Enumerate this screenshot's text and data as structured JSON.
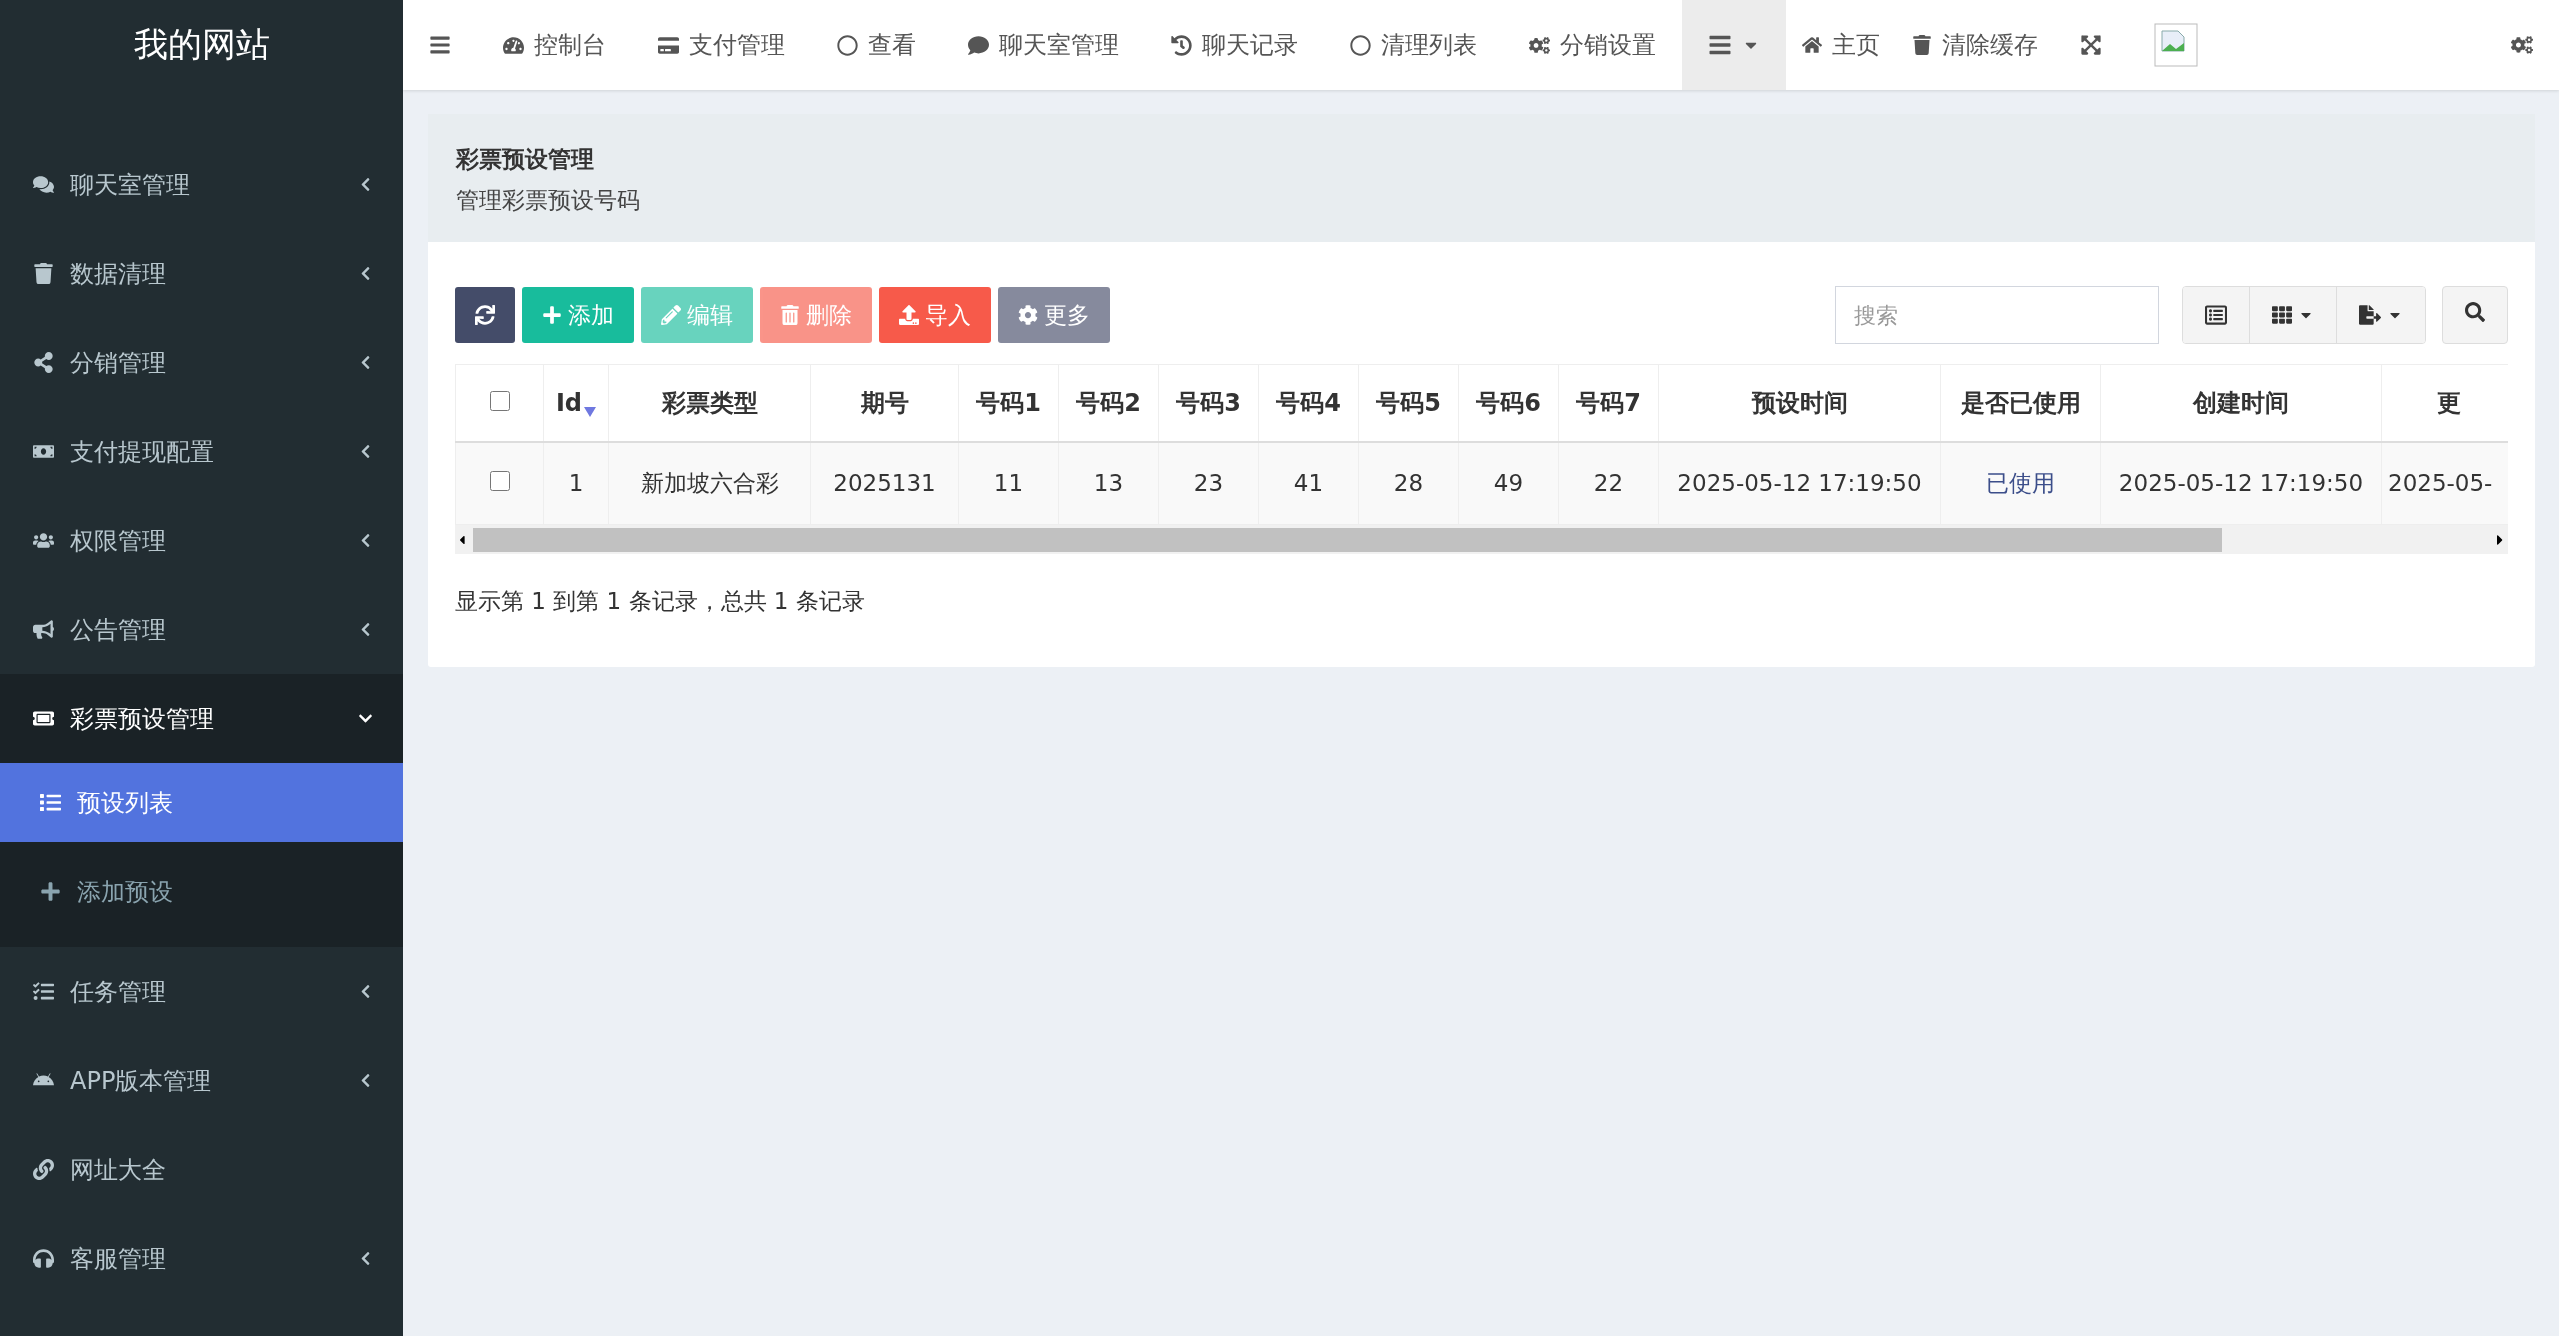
{
  "site_title": "我的网站",
  "nav": {
    "tabs": [
      {
        "label": "控制台"
      },
      {
        "label": "支付管理"
      },
      {
        "label": "查看"
      },
      {
        "label": "聊天室管理"
      },
      {
        "label": "聊天记录"
      },
      {
        "label": "清理列表"
      },
      {
        "label": "分销设置"
      }
    ],
    "menu_open": true,
    "right_links": [
      {
        "label": "主页"
      },
      {
        "label": "清除缓存"
      }
    ]
  },
  "sidebar": {
    "items": [
      {
        "label": "聊天室管理",
        "kind": "group",
        "expanded": false
      },
      {
        "label": "数据清理",
        "kind": "group",
        "expanded": false
      },
      {
        "label": "分销管理",
        "kind": "group",
        "expanded": false
      },
      {
        "label": "支付提现配置",
        "kind": "group",
        "expanded": false
      },
      {
        "label": "权限管理",
        "kind": "group",
        "expanded": false
      },
      {
        "label": "公告管理",
        "kind": "group",
        "expanded": false
      },
      {
        "label": "彩票预设管理",
        "kind": "group",
        "expanded": true,
        "children": [
          {
            "label": "预设列表",
            "selected": true
          },
          {
            "label": "添加预设",
            "selected": false
          }
        ]
      },
      {
        "label": "任务管理",
        "kind": "group",
        "expanded": false
      },
      {
        "label": "APP版本管理",
        "kind": "group",
        "expanded": false
      },
      {
        "label": "网址大全",
        "kind": "link"
      },
      {
        "label": "客服管理",
        "kind": "group",
        "expanded": false
      }
    ]
  },
  "page": {
    "title": "彩票预设管理",
    "subtitle": "管理彩票预设号码"
  },
  "toolbar": {
    "buttons": [
      {
        "kind": "refresh",
        "disabled": false
      },
      {
        "kind": "add",
        "label": "添加",
        "disabled": false
      },
      {
        "kind": "edit",
        "label": "编辑",
        "disabled": true
      },
      {
        "kind": "delete",
        "label": "删除",
        "disabled": true
      },
      {
        "kind": "import",
        "label": "导入",
        "disabled": false
      },
      {
        "kind": "more",
        "label": "更多",
        "disabled": false
      }
    ],
    "search": {
      "placeholder": "搜索"
    }
  },
  "table": {
    "header_checked": false,
    "columns": [
      {
        "label": "Id",
        "sorted": true
      },
      {
        "label": "彩票类型",
        "sorted": false
      },
      {
        "label": "期号",
        "sorted": false
      },
      {
        "label": "号码1",
        "sorted": false
      },
      {
        "label": "号码2",
        "sorted": false
      },
      {
        "label": "号码3",
        "sorted": false
      },
      {
        "label": "号码4",
        "sorted": false
      },
      {
        "label": "号码5",
        "sorted": false
      },
      {
        "label": "号码6",
        "sorted": false
      },
      {
        "label": "号码7",
        "sorted": false
      },
      {
        "label": "预设时间",
        "sorted": false
      },
      {
        "label": "是否已使用",
        "sorted": false
      },
      {
        "label": "创建时间",
        "sorted": false
      },
      {
        "label": "更",
        "sorted": false
      }
    ],
    "rows": [
      {
        "checked": false,
        "cells": [
          {
            "text": "1",
            "kind": "text"
          },
          {
            "text": "新加坡六合彩",
            "kind": "text"
          },
          {
            "text": "2025131",
            "kind": "text"
          },
          {
            "text": "11",
            "kind": "text"
          },
          {
            "text": "13",
            "kind": "text"
          },
          {
            "text": "23",
            "kind": "text"
          },
          {
            "text": "41",
            "kind": "text"
          },
          {
            "text": "28",
            "kind": "text"
          },
          {
            "text": "49",
            "kind": "text"
          },
          {
            "text": "22",
            "kind": "text"
          },
          {
            "text": "2025-05-12 17:19:50",
            "kind": "text"
          },
          {
            "text": "已使用",
            "kind": "status"
          },
          {
            "text": "2025-05-12 17:19:50",
            "kind": "text"
          },
          {
            "text": "2025-05-",
            "kind": "text"
          }
        ]
      }
    ]
  },
  "pagination_info": "显示第 1 到第 1 条记录，总共 1 条记录"
}
